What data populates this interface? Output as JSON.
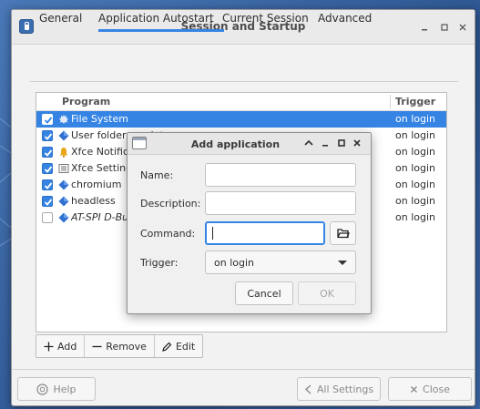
{
  "window": {
    "title": "Session and Startup"
  },
  "tabs": [
    {
      "label": "General"
    },
    {
      "label": "Application Autostart"
    },
    {
      "label": "Current Session"
    },
    {
      "label": "Advanced"
    }
  ],
  "list": {
    "columns": {
      "program": "Program",
      "trigger": "Trigger"
    },
    "rows": [
      {
        "name": "File System",
        "trigger": "on login",
        "checked": true,
        "selected": true,
        "icon": "gear-icon"
      },
      {
        "name": "User folders update",
        "trigger": "on login",
        "checked": true,
        "selected": false,
        "icon": "diamond-icon"
      },
      {
        "name": "Xfce Notification",
        "trigger": "on login",
        "checked": true,
        "selected": false,
        "icon": "bell-icon"
      },
      {
        "name": "Xfce Settings",
        "trigger": "on login",
        "checked": true,
        "selected": false,
        "icon": "settings-icon"
      },
      {
        "name": "chromium",
        "trigger": "on login",
        "checked": true,
        "selected": false,
        "icon": "diamond-icon"
      },
      {
        "name": "headless",
        "trigger": "on login",
        "checked": true,
        "selected": false,
        "icon": "diamond-icon"
      },
      {
        "name": "AT-SPI D-Bus",
        "trigger": "on login",
        "checked": false,
        "selected": false,
        "icon": "diamond-icon"
      }
    ]
  },
  "toolbar": {
    "add_label": "Add",
    "remove_label": "Remove",
    "edit_label": "Edit"
  },
  "footer": {
    "help_label": "Help",
    "all_settings_label": "All Settings",
    "close_label": "Close"
  },
  "dialog": {
    "title": "Add application",
    "name_label": "Name:",
    "name_value": "",
    "description_label": "Description:",
    "description_value": "",
    "command_label": "Command:",
    "command_value": "",
    "trigger_label": "Trigger:",
    "trigger_value": "on login",
    "cancel_label": "Cancel",
    "ok_label": "OK"
  },
  "colors": {
    "accent": "#3584e4",
    "icon_blue": "#2f6fd0",
    "bell_yellow": "#e8a617"
  }
}
